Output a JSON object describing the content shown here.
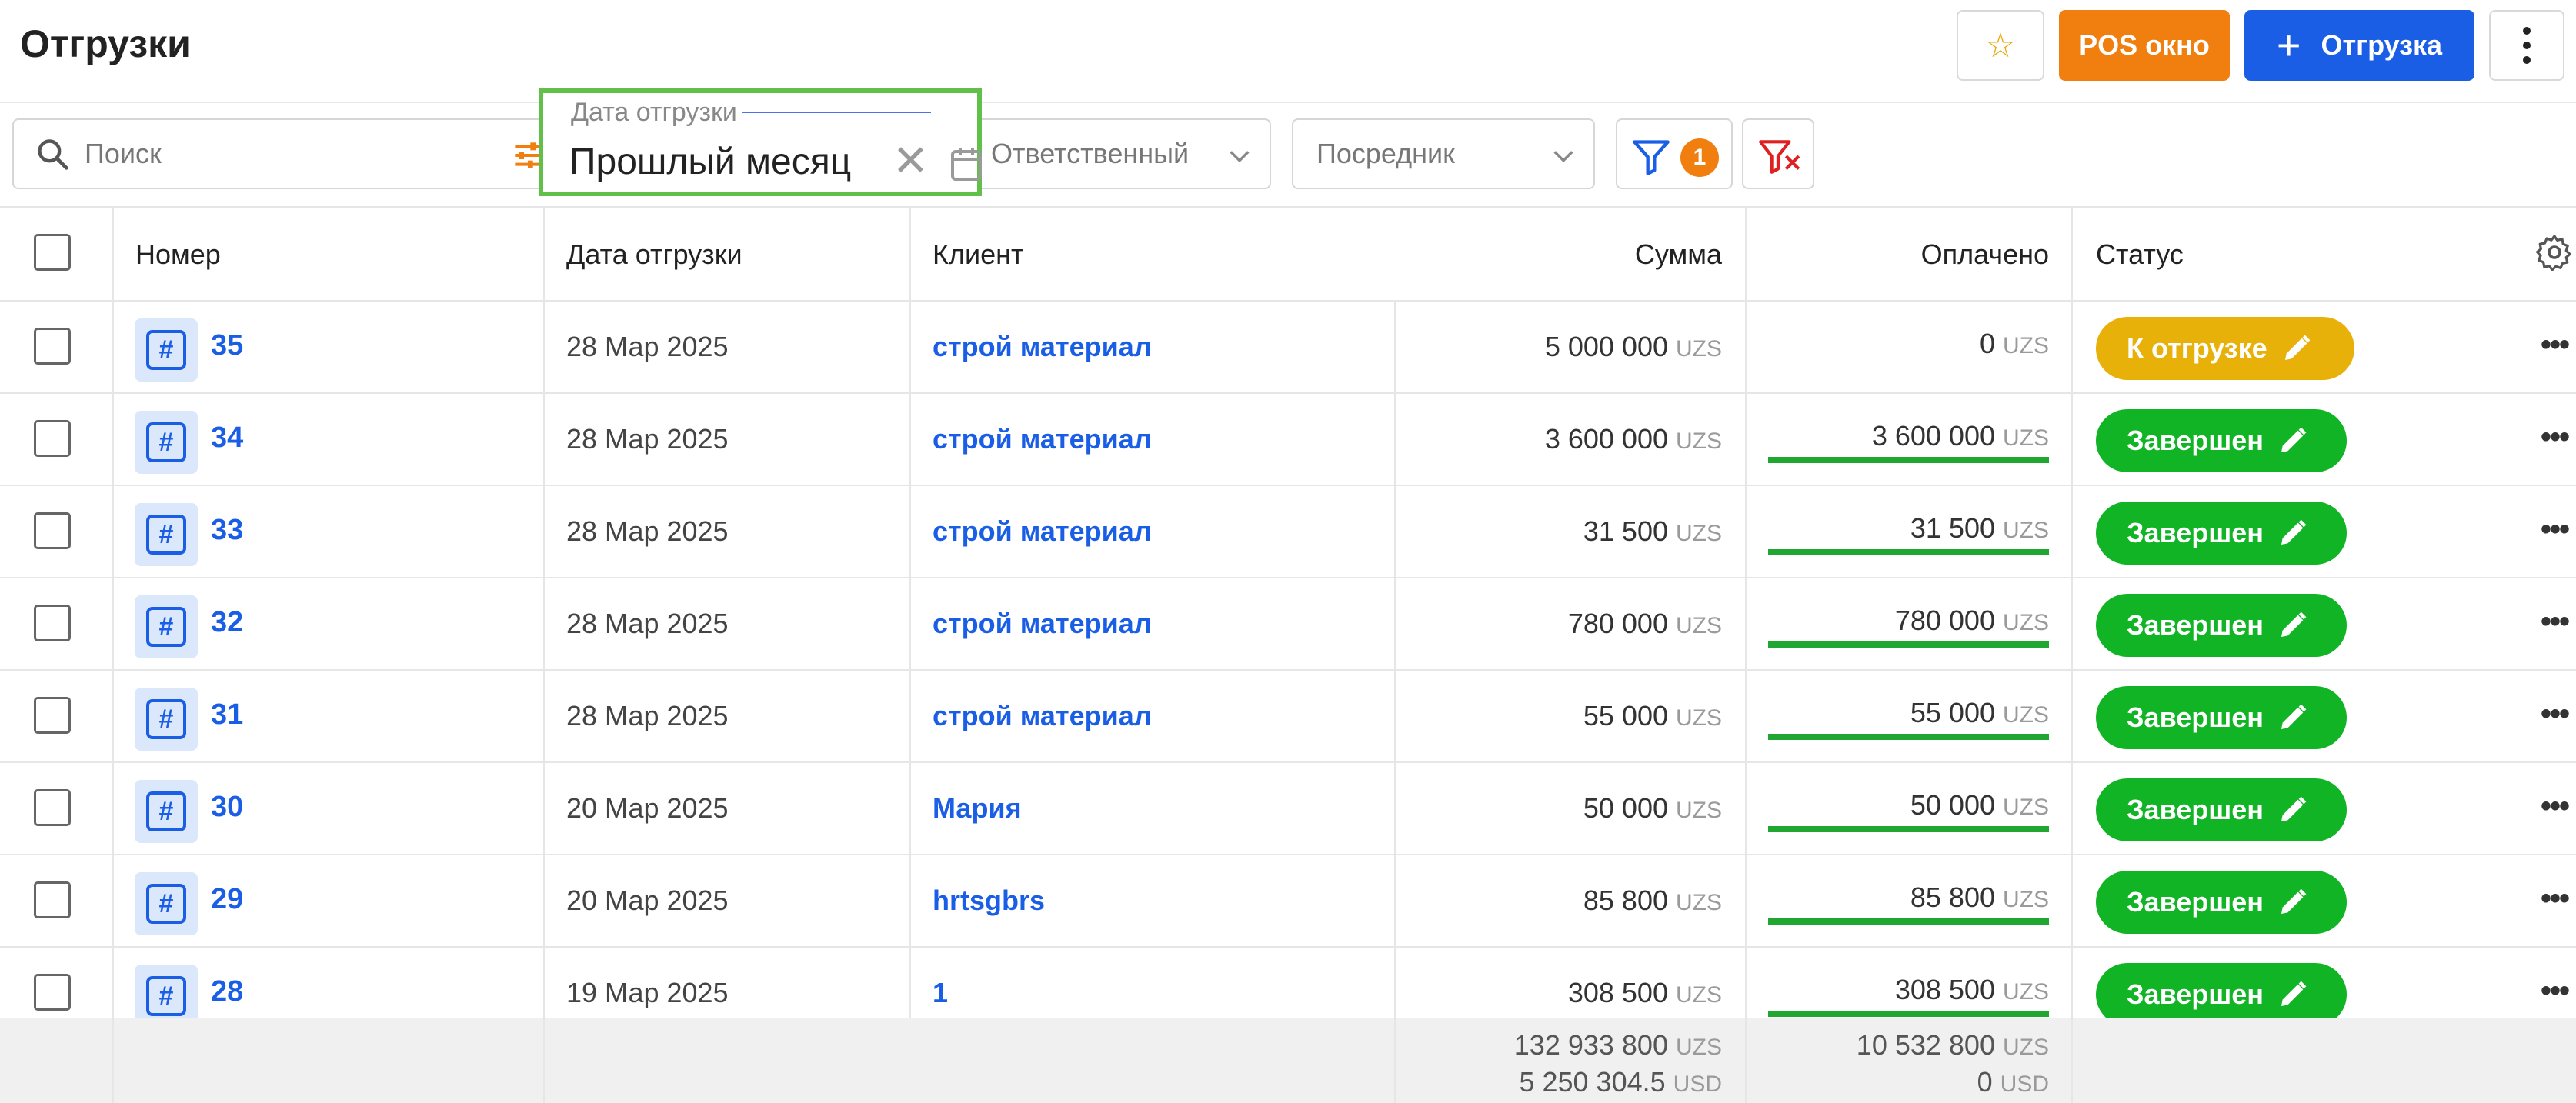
{
  "header": {
    "title": "Отгрузки",
    "pos_label": "POS окно",
    "add_label": "Отгрузка"
  },
  "filters": {
    "search_placeholder": "Поиск",
    "date_label": "Дата отгрузки",
    "date_value": "Прошлый месяц",
    "responsible_placeholder": "Ответственный",
    "agent_placeholder": "Посредник",
    "filter_count": "1"
  },
  "columns": {
    "number": "Номер",
    "date": "Дата отгрузки",
    "client": "Клиент",
    "sum": "Сумма",
    "paid": "Оплачено",
    "status": "Статус"
  },
  "currency": "UZS",
  "rows": [
    {
      "number": "35",
      "date": "28 Мар 2025",
      "client": "строй материал",
      "sum": "5 000 000",
      "paid": "0",
      "paid_fraction": 0,
      "status": "К отгрузке",
      "status_color": "#e8b10a"
    },
    {
      "number": "34",
      "date": "28 Мар 2025",
      "client": "строй материал",
      "sum": "3 600 000",
      "paid": "3 600 000",
      "paid_fraction": 1,
      "status": "Завершен",
      "status_color": "#11b425"
    },
    {
      "number": "33",
      "date": "28 Мар 2025",
      "client": "строй материал",
      "sum": "31 500",
      "paid": "31 500",
      "paid_fraction": 1,
      "status": "Завершен",
      "status_color": "#11b425"
    },
    {
      "number": "32",
      "date": "28 Мар 2025",
      "client": "строй материал",
      "sum": "780 000",
      "paid": "780 000",
      "paid_fraction": 1,
      "status": "Завершен",
      "status_color": "#11b425"
    },
    {
      "number": "31",
      "date": "28 Мар 2025",
      "client": "строй материал",
      "sum": "55 000",
      "paid": "55 000",
      "paid_fraction": 1,
      "status": "Завершен",
      "status_color": "#11b425"
    },
    {
      "number": "30",
      "date": "20 Мар 2025",
      "client": "Мария",
      "sum": "50 000",
      "paid": "50 000",
      "paid_fraction": 1,
      "status": "Завершен",
      "status_color": "#11b425"
    },
    {
      "number": "29",
      "date": "20 Мар 2025",
      "client": "hrtsgbrs",
      "sum": "85 800",
      "paid": "85 800",
      "paid_fraction": 1,
      "status": "Завершен",
      "status_color": "#11b425"
    },
    {
      "number": "28",
      "date": "19 Мар 2025",
      "client": "1",
      "sum": "308 500",
      "paid": "308 500",
      "paid_fraction": 1,
      "status": "Завершен",
      "status_color": "#11b425"
    }
  ],
  "totals": {
    "sum_uzs": "132 933 800",
    "sum_usd": "5 250 304.5",
    "paid_uzs": "10 532 800",
    "paid_usd": "0",
    "currency_uzs": "UZS",
    "currency_usd": "USD"
  },
  "icons": {
    "star": "star-icon",
    "plus": "plus-icon",
    "more": "more-vertical-icon",
    "search": "search-icon",
    "sliders": "sliders-icon",
    "clear": "close-icon",
    "calendar": "calendar-icon",
    "chevron": "chevron-down-icon",
    "filter": "filter-icon",
    "filter_clear": "filter-clear-icon",
    "gear": "gear-icon",
    "hash": "hash-icon",
    "edit": "pencil-icon"
  },
  "colors": {
    "primary": "#1b5ee6",
    "orange": "#f07f10",
    "success": "#11b425",
    "warning": "#e8b10a",
    "focus_outline": "#62c04a"
  }
}
